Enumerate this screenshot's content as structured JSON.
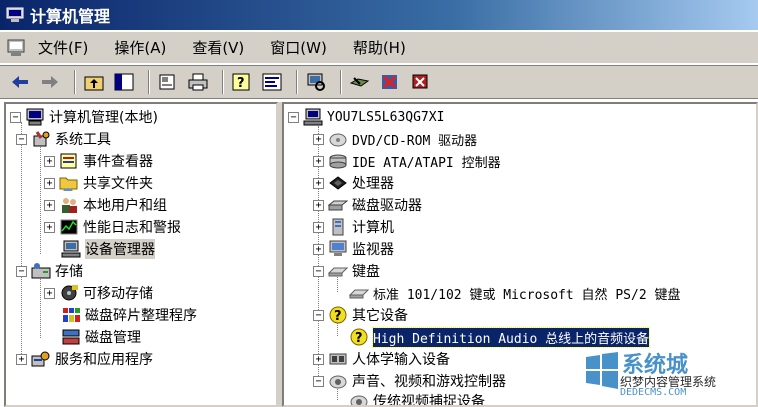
{
  "window": {
    "title": "计算机管理"
  },
  "menu": [
    "文件(F)",
    "操作(A)",
    "查看(V)",
    "窗口(W)",
    "帮助(H)"
  ],
  "left_tree": [
    {
      "label": "计算机管理(本地)",
      "expander": "−",
      "icon": "computer-management-icon"
    },
    {
      "label": "系统工具",
      "expander": "−",
      "icon": "system-tools-icon"
    },
    {
      "label": "事件查看器",
      "expander": "+",
      "icon": "event-viewer-icon"
    },
    {
      "label": "共享文件夹",
      "expander": "+",
      "icon": "shared-folder-icon"
    },
    {
      "label": "本地用户和组",
      "expander": "+",
      "icon": "users-icon"
    },
    {
      "label": "性能日志和警报",
      "expander": "+",
      "icon": "performance-icon"
    },
    {
      "label": "设备管理器",
      "expander": "",
      "icon": "device-manager-icon"
    },
    {
      "label": "存储",
      "expander": "−",
      "icon": "storage-icon"
    },
    {
      "label": "可移动存储",
      "expander": "+",
      "icon": "removable-storage-icon"
    },
    {
      "label": "磁盘碎片整理程序",
      "expander": "",
      "icon": "defrag-icon"
    },
    {
      "label": "磁盘管理",
      "expander": "",
      "icon": "disk-management-icon"
    },
    {
      "label": "服务和应用程序",
      "expander": "+",
      "icon": "services-icon"
    }
  ],
  "right_tree": [
    {
      "label": "YOU7LS5L63QG7XI",
      "expander": "−",
      "icon": "computer-icon"
    },
    {
      "label": "DVD/CD-ROM 驱动器",
      "expander": "+",
      "icon": "dvd-icon"
    },
    {
      "label": "IDE ATA/ATAPI 控制器",
      "expander": "+",
      "icon": "ide-icon"
    },
    {
      "label": "处理器",
      "expander": "+",
      "icon": "processor-icon"
    },
    {
      "label": "磁盘驱动器",
      "expander": "+",
      "icon": "disk-drive-icon"
    },
    {
      "label": "计算机",
      "expander": "+",
      "icon": "computer-icon"
    },
    {
      "label": "监视器",
      "expander": "+",
      "icon": "monitor-icon"
    },
    {
      "label": "键盘",
      "expander": "−",
      "icon": "keyboard-icon"
    },
    {
      "label": "标准 101/102 键或 Microsoft 自然 PS/2 键盘",
      "expander": "",
      "icon": "keyboard-icon"
    },
    {
      "label": "其它设备",
      "expander": "−",
      "icon": "unknown-device-icon"
    },
    {
      "label": "High Definition Audio 总线上的音频设备",
      "expander": "",
      "icon": "unknown-device-icon"
    },
    {
      "label": "人体学输入设备",
      "expander": "+",
      "icon": "hid-icon"
    },
    {
      "label": "声音、视频和游戏控制器",
      "expander": "−",
      "icon": "sound-icon"
    },
    {
      "label": "传统视频捕捉设备",
      "expander": "",
      "icon": "sound-icon"
    }
  ],
  "watermark": {
    "brand": "系统城",
    "line1": "织梦内容管理系统",
    "line2": "DEDECMS.COM"
  },
  "colors": {
    "title_start": "#0a246a",
    "title_end": "#a6caf0",
    "selection": "#0a246a",
    "chrome": "#d4d0c8"
  }
}
